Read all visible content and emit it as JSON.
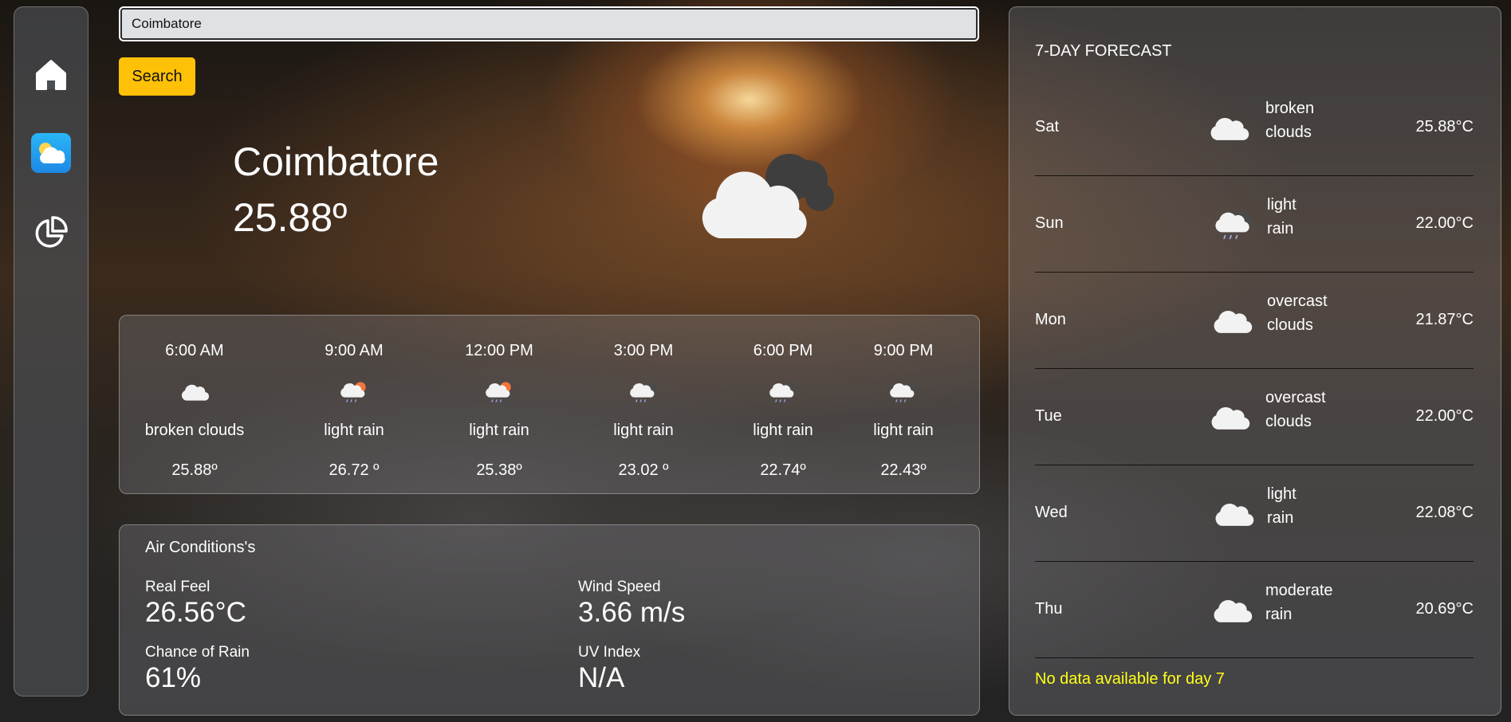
{
  "search": {
    "value": "Coimbatore",
    "button_label": "Search"
  },
  "nav": {
    "items": [
      "home-icon",
      "weather-icon",
      "pie-chart-icon"
    ],
    "active": "weather-icon"
  },
  "current": {
    "city": "Coimbatore",
    "temp": "25.88º",
    "icon": "cloud-with-dark-clouds-icon"
  },
  "hourly": [
    {
      "time": "6:00 AM",
      "icon": "cloud-icon",
      "desc": "broken clouds",
      "temp": "25.88º"
    },
    {
      "time": "9:00 AM",
      "icon": "sun-rain-cloud-icon",
      "desc": "light rain",
      "temp": "26.72 º"
    },
    {
      "time": "12:00 PM",
      "icon": "sun-rain-cloud-icon",
      "desc": "light rain",
      "temp": "25.38º"
    },
    {
      "time": "3:00 PM",
      "icon": "rain-cloud-icon",
      "desc": "light rain",
      "temp": "23.02 º"
    },
    {
      "time": "6:00 PM",
      "icon": "rain-cloud-icon",
      "desc": "light rain",
      "temp": "22.74º"
    },
    {
      "time": "9:00 PM",
      "icon": "rain-cloud-icon",
      "desc": "light rain",
      "temp": "22.43º"
    }
  ],
  "air": {
    "title": "Air Conditions's",
    "real_feel_label": "Real Feel",
    "real_feel": "26.56°C",
    "wind_label": "Wind Speed",
    "wind": "3.66 m/s",
    "rain_label": "Chance of Rain",
    "rain": "61%",
    "uv_label": "UV Index",
    "uv": "N/A"
  },
  "forecast": {
    "title": "7-DAY FORECAST",
    "days": [
      {
        "day": "Sat",
        "icon": "cloud-icon",
        "desc1": "broken",
        "desc2": "clouds",
        "temp": "25.88°C"
      },
      {
        "day": "Sun",
        "icon": "rain-cloud-icon",
        "desc1": "light",
        "desc2": "rain",
        "temp": "22.00°C"
      },
      {
        "day": "Mon",
        "icon": "cloud-icon",
        "desc1": "overcast",
        "desc2": "clouds",
        "temp": "21.87°C"
      },
      {
        "day": "Tue",
        "icon": "cloud-icon",
        "desc1": "overcast",
        "desc2": "clouds",
        "temp": "22.00°C"
      },
      {
        "day": "Wed",
        "icon": "cloud-icon",
        "desc1": "light",
        "desc2": "rain",
        "temp": "22.08°C"
      },
      {
        "day": "Thu",
        "icon": "cloud-icon",
        "desc1": "moderate",
        "desc2": "rain",
        "temp": "20.69°C"
      }
    ],
    "no_data": "No data available for day 7"
  },
  "colors": {
    "accent": "#ffc107",
    "warning_text": "#ffff19",
    "weather_icon_bg": "#29b6f6"
  }
}
